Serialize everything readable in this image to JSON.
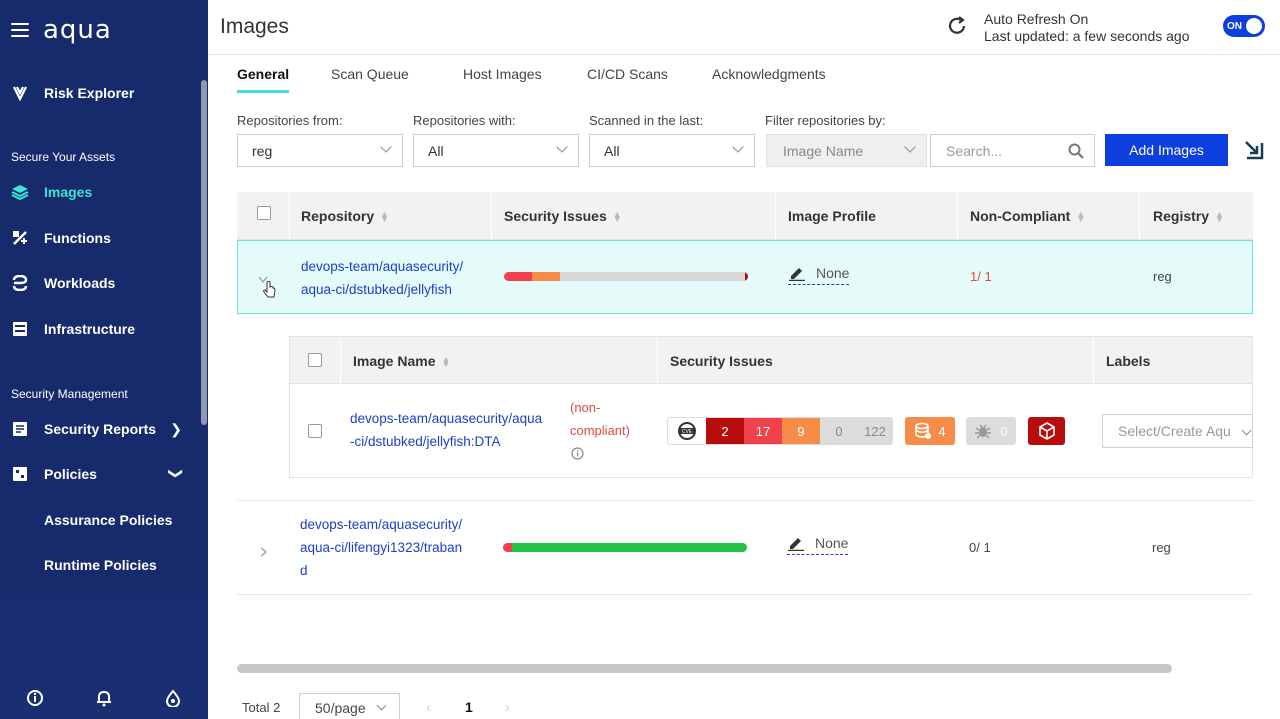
{
  "app": {
    "logo": "aqua"
  },
  "sidebar": {
    "items": [
      {
        "label": "Risk Explorer"
      },
      {
        "label": "Images"
      },
      {
        "label": "Functions"
      },
      {
        "label": "Workloads"
      },
      {
        "label": "Infrastructure"
      },
      {
        "label": "Security Reports"
      },
      {
        "label": "Policies"
      }
    ],
    "sections": [
      "Secure Your Assets",
      "Security Management"
    ],
    "subitems": [
      "Assurance Policies",
      "Runtime Policies"
    ]
  },
  "header": {
    "title": "Images",
    "auto_refresh": "Auto Refresh On",
    "last_updated": "Last updated: a few seconds ago",
    "toggle": "ON"
  },
  "tabs": [
    "General",
    "Scan Queue",
    "Host Images",
    "CI/CD Scans",
    "Acknowledgments"
  ],
  "filters": {
    "repos_from": {
      "label": "Repositories from:",
      "value": "reg"
    },
    "repos_with": {
      "label": "Repositories with:",
      "value": "All"
    },
    "scanned": {
      "label": "Scanned in the last:",
      "value": "All"
    },
    "filter_by": {
      "label": "Filter repositories by:",
      "value": "Image Name"
    },
    "search_placeholder": "Search...",
    "add_button": "Add Images"
  },
  "table": {
    "columns": [
      "Repository",
      "Security Issues",
      "Image Profile",
      "Non-Compliant",
      "Registry"
    ],
    "rows": [
      {
        "repo_line1": "devops-team/aquasecurity/",
        "repo_line2": "aqua-ci/dstubked/jellyfish",
        "profile": "None",
        "noncompliant": "1/ 1",
        "registry": "reg"
      },
      {
        "repo_line1": "devops-team/aquasecurity/",
        "repo_line2": "aqua-ci/lifengyi1323/traban",
        "repo_line3": "d",
        "profile": "None",
        "noncompliant": "0/ 1",
        "registry": "reg"
      }
    ]
  },
  "inner_table": {
    "columns": [
      "Image Name",
      "Security Issues",
      "Labels"
    ],
    "row": {
      "name_line1": "devops-team/aquasecurity/aqua",
      "name_line2": "-ci/dstubked/jellyfish:DTA",
      "status_line1": "(non-",
      "status_line2": "compliant)",
      "cve_counts": {
        "critical": "2",
        "high": "17",
        "medium": "9",
        "low": "0",
        "negligible": "122"
      },
      "malware": "4",
      "vuln": "0",
      "labels_placeholder": "Select/Create Aqu"
    }
  },
  "pagination": {
    "total": "Total 2",
    "page_size": "50/page",
    "current": "1"
  },
  "colors": {
    "sidebar_bg": "#172a6b",
    "accent": "#3de3d3",
    "primary": "#0d3fde",
    "critical": "#b80d0d",
    "high": "#f0414c",
    "medium": "#f68c48",
    "low": "#d9d9d9",
    "neg": "#d9d9d9"
  }
}
